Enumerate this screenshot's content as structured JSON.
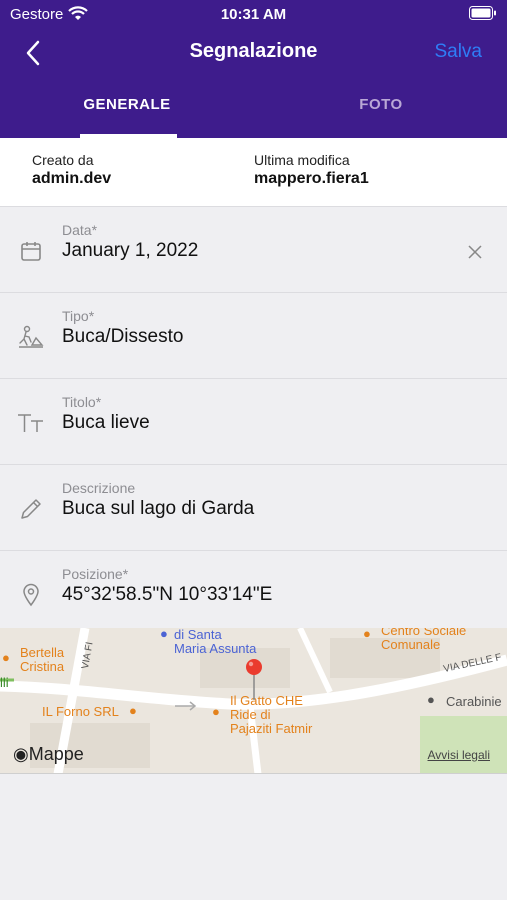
{
  "status_bar": {
    "carrier": "Gestore",
    "time": "10:31 AM"
  },
  "nav": {
    "title": "Segnalazione",
    "save_label": "Salva"
  },
  "tabs": [
    {
      "label": "GENERALE",
      "active": true
    },
    {
      "label": "FOTO",
      "active": false
    }
  ],
  "meta": {
    "created_by_label": "Creato da",
    "created_by_value": "admin.dev",
    "modified_label": "Ultima modifica",
    "modified_value": "mappero.fiera1"
  },
  "fields": {
    "data": {
      "label": "Data*",
      "value": "January 1, 2022",
      "icon": "calendar-icon"
    },
    "tipo": {
      "label": "Tipo*",
      "value": "Buca/Dissesto",
      "icon": "road-work-icon"
    },
    "titolo": {
      "label": "Titolo*",
      "value": "Buca lieve",
      "icon": "text-size-icon"
    },
    "descrizione": {
      "label": "Descrizione",
      "value": "Buca sul lago di Garda",
      "icon": "pencil-icon"
    },
    "posizione": {
      "label": "Posizione*",
      "value": "45°32'58.5\"N 10°33'14\"E",
      "icon": "location-pin-icon"
    }
  },
  "map": {
    "labels": {
      "santa_maria": "di Santa\nMaria Assunta",
      "centro_sociale": "Centro Sociale\nComunale",
      "bertella": "Bertella\nCristina",
      "via_fi": "VIA FI",
      "via_delle": "VIA DELLE F",
      "lli": "lli",
      "il_forno": "IL Forno SRL",
      "il_gatto": "Il Gatto CHE\nRide di\nPajaziti Fatmir",
      "carabinieri": "Carabinie"
    },
    "brand": "Mappe",
    "legal": "Avvisi legali"
  }
}
